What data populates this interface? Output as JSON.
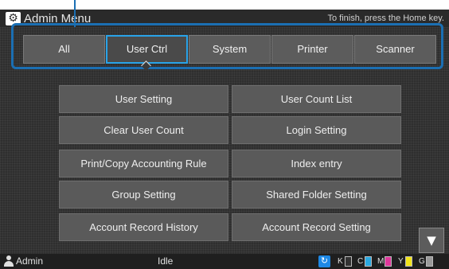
{
  "header": {
    "title": "Admin Menu",
    "hint": "To finish, press the Home key.",
    "icon": "gear-icon"
  },
  "tabs": [
    {
      "label": "All",
      "active": false
    },
    {
      "label": "User Ctrl",
      "active": true
    },
    {
      "label": "System",
      "active": false
    },
    {
      "label": "Printer",
      "active": false
    },
    {
      "label": "Scanner",
      "active": false
    }
  ],
  "menu": [
    [
      "User Setting",
      "User Count List"
    ],
    [
      "Clear User Count",
      "Login Setting"
    ],
    [
      "Print/Copy Accounting Rule",
      "Index entry"
    ],
    [
      "Group Setting",
      "Shared Folder Setting"
    ],
    [
      "Account Record History",
      "Account Record Setting"
    ]
  ],
  "scroll": {
    "icon": "triangle-down-icon",
    "glyph": "▼"
  },
  "status_bar": {
    "user": "Admin",
    "status": "Idle",
    "toner": [
      {
        "label": "K",
        "color": "#333333"
      },
      {
        "label": "C",
        "color": "#2aa8e0"
      },
      {
        "label": "M",
        "color": "#e0379b"
      },
      {
        "label": "Y",
        "color": "#f2e41a"
      },
      {
        "label": "G",
        "color": "#9a9a9a"
      }
    ]
  },
  "accent": {
    "highlight": "#1b6fb3",
    "active_tab": "#29a3e8"
  }
}
